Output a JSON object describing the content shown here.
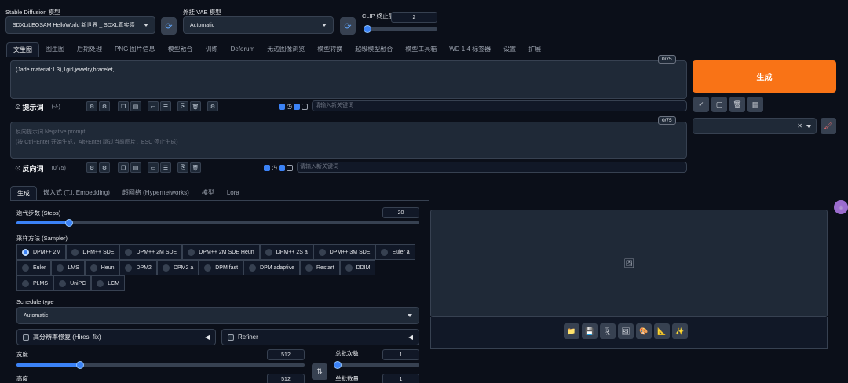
{
  "top": {
    "model_label": "Stable Diffusion 模型",
    "model_value": "SDXL\\LEOSAM HelloWorld 新世界 _ SDXL真实感",
    "vae_label": "外挂 VAE 模型",
    "vae_value": "Automatic",
    "clip_label": "CLIP 终止层数",
    "clip_value": "2"
  },
  "main_tabs": [
    "文生图",
    "图生图",
    "后期处理",
    "PNG 图片信息",
    "模型融合",
    "训练",
    "Deforum",
    "无边图像浏览",
    "模型转换",
    "超级模型融合",
    "模型工具箱",
    "WD 1.4 标签器",
    "设置",
    "扩展"
  ],
  "prompt": {
    "text": "(Jade material:1.3),1girl,jewelry,bracelet,",
    "counter": "0/75",
    "label": "提示词",
    "sub": "(-/-)",
    "keyword_placeholder": "请输入新关键词"
  },
  "negative": {
    "placeholder_line1": "反向提示词 Negative prompt",
    "placeholder_line2": "(按 Ctrl+Enter 开始生成，Alt+Enter 跳过当前图片，ESC 停止生成)",
    "counter": "0/75",
    "label": "反向词",
    "sub": "(0/75)",
    "keyword_placeholder": "请输入新关键词"
  },
  "generate_label": "生成",
  "sub_tabs": [
    "生成",
    "嵌入式 (T.I. Embedding)",
    "超网络 (Hypernetworks)",
    "模型",
    "Lora"
  ],
  "steps": {
    "label": "迭代步数 (Steps)",
    "value": "20",
    "fraction": 0.13
  },
  "sampler": {
    "label": "采样方法 (Sampler)",
    "row1": [
      "DPM++ 2M",
      "DPM++ SDE",
      "DPM++ 2M SDE",
      "DPM++ 2M SDE Heun",
      "DPM++ 2S a",
      "DPM++ 3M SDE",
      "Euler a"
    ],
    "row2": [
      "Euler",
      "LMS",
      "Heun",
      "DPM2",
      "DPM2 a",
      "DPM fast",
      "DPM adaptive",
      "Restart",
      "DDIM"
    ],
    "row3": [
      "PLMS",
      "UniPC",
      "LCM"
    ],
    "selected": "DPM++ 2M"
  },
  "schedule": {
    "label": "Schedule type",
    "value": "Automatic"
  },
  "hires_label": "高分辨率修复 (Hires. fix)",
  "refiner_label": "Refiner",
  "width": {
    "label": "宽度",
    "value": "512",
    "fraction": 0.22
  },
  "height": {
    "label": "高度",
    "value": "512"
  },
  "batch_count": {
    "label": "总批次数",
    "value": "1",
    "fraction": 0.0
  },
  "batch_size": {
    "label": "单批数量",
    "value": "1"
  },
  "colors": {
    "accent": "#3b82f6",
    "generate": "#f97316"
  }
}
